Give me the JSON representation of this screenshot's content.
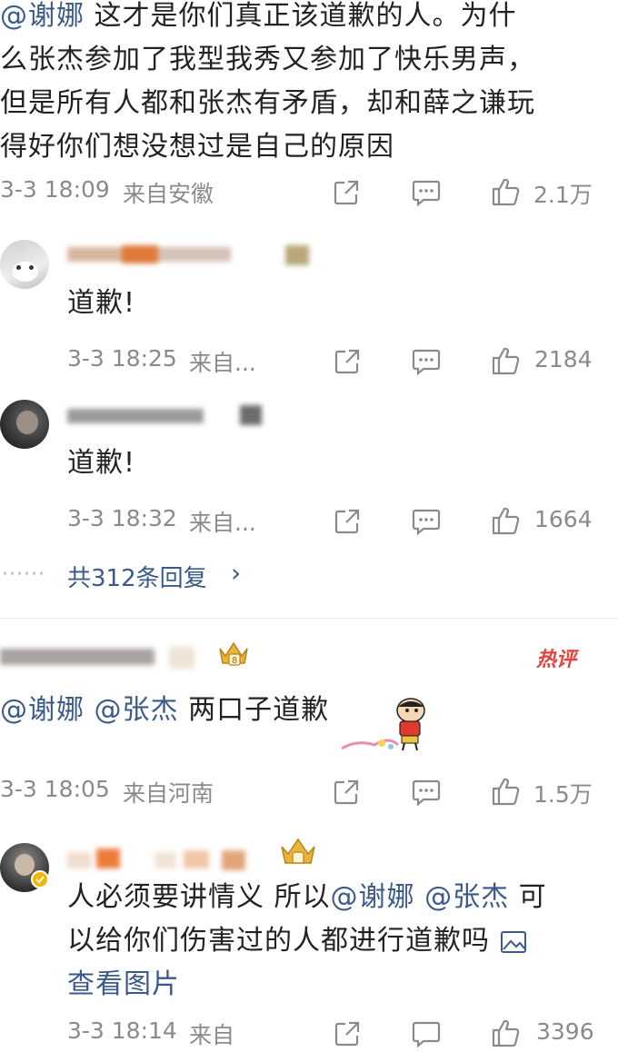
{
  "comment_top": {
    "mention": "@谢娜",
    "text_line1": "这才是你们真正该道歉的人。为什",
    "text_line2": "么张杰参加了我型我秀又参加了快乐男声，",
    "text_line3": "但是所有人都和张杰有矛盾，却和薛之谦玩",
    "text_line4": "得好你们想没想过是自己的原因",
    "time": "3-3 18:09",
    "location": "来自安徽",
    "likes": "2.1万"
  },
  "reply_1": {
    "text": "道歉!",
    "time": "3-3 18:25",
    "location": "来自...",
    "likes": "2184"
  },
  "reply_2": {
    "text": "道歉!",
    "time": "3-3 18:32",
    "location": "来自...",
    "likes": "1664"
  },
  "replies_more": {
    "dots": "······",
    "label": "共312条回复",
    "chevron": "›"
  },
  "comment_hot": {
    "badge": "热评",
    "mention1": "@谢娜",
    "mention2": "@张杰",
    "text": "两口子道歉",
    "time": "3-3 18:05",
    "location": "来自河南",
    "likes": "1.5万"
  },
  "comment_last": {
    "line1_text": "人必须要讲情义 所以",
    "mention1": "@谢娜",
    "mention2": "@张杰",
    "line1_tail": "可",
    "line2_text": "以给你们伤害过的人都进行道歉吗",
    "view_image": "查看图片",
    "time": "3-3 18:14",
    "location": "来自",
    "likes": "3396"
  },
  "colors": {
    "link": "#3a5a8c",
    "meta": "#8a8a8a",
    "hot_badge": "#e8413d",
    "text": "#222222"
  },
  "icons": [
    "share-icon",
    "comment-icon",
    "like-icon",
    "chevron-right-icon",
    "image-icon",
    "crown-badge-icon",
    "verified-icon"
  ]
}
